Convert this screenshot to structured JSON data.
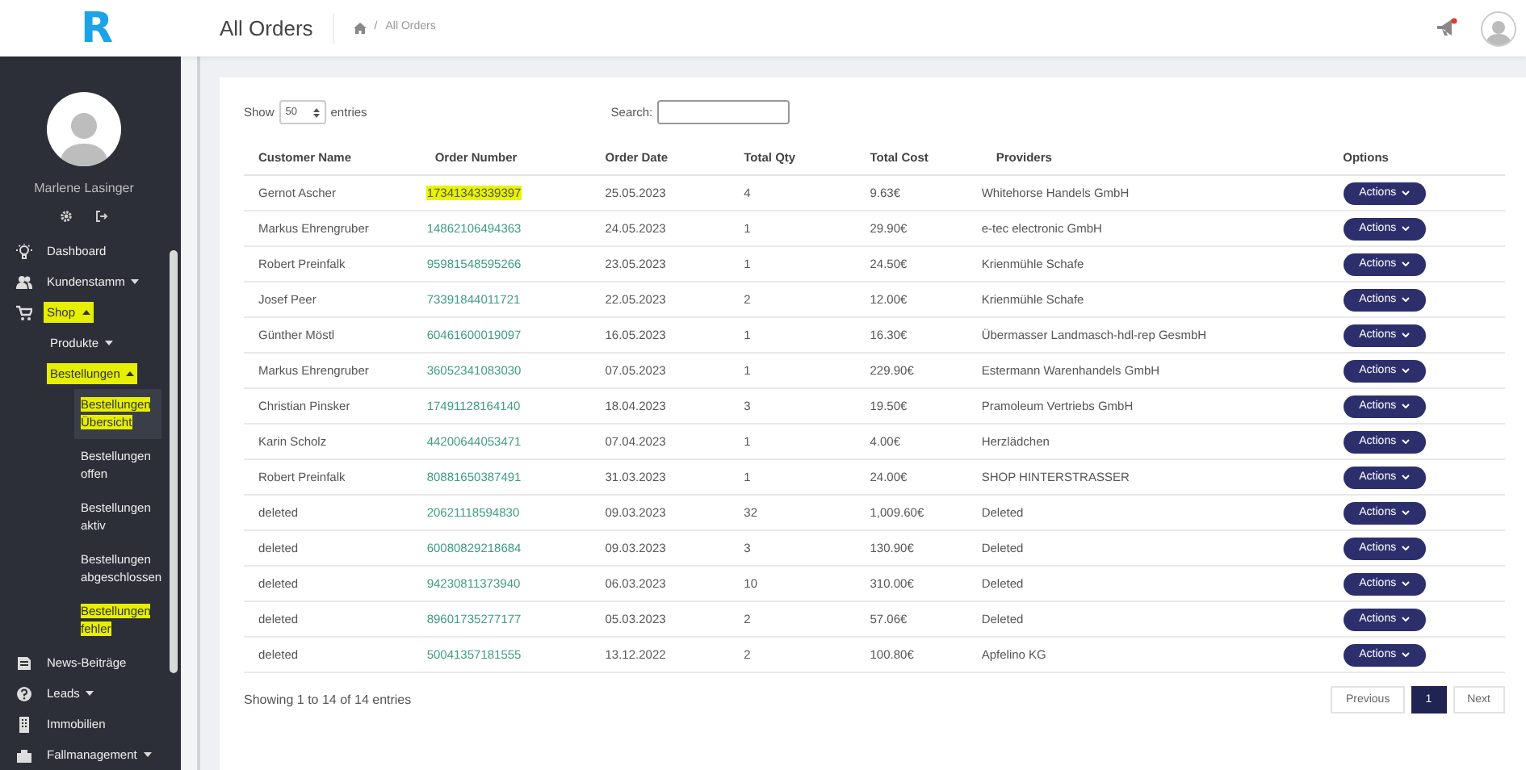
{
  "header": {
    "logo": "R",
    "title": "All Orders",
    "breadcrumb": {
      "separator": "/",
      "current": "All Orders"
    }
  },
  "profile": {
    "name": "Marlene Lasinger"
  },
  "sidebar": {
    "items": [
      {
        "label": "Dashboard",
        "highlighted": false
      },
      {
        "label": "Kundenstamm",
        "expanded": false,
        "highlighted": false
      },
      {
        "label": "Shop",
        "expanded": true,
        "highlighted": true,
        "children": [
          {
            "label": "Produkte",
            "expanded": false,
            "highlighted": false
          },
          {
            "label": "Bestellungen",
            "expanded": true,
            "highlighted": true,
            "children": [
              {
                "label": "Bestellungen Übersicht",
                "selected": true,
                "highlighted": true
              },
              {
                "label": "Bestellungen offen",
                "selected": false,
                "highlighted": false
              },
              {
                "label": "Bestellungen aktiv",
                "selected": false,
                "highlighted": false
              },
              {
                "label": "Bestellungen abgeschlossen",
                "selected": false,
                "highlighted": false
              },
              {
                "label": "Bestellungen fehler",
                "selected": false,
                "highlighted": true
              }
            ]
          }
        ]
      },
      {
        "label": "News-Beiträge",
        "highlighted": false
      },
      {
        "label": "Leads",
        "expanded": false,
        "highlighted": false
      },
      {
        "label": "Immobilien",
        "highlighted": false
      },
      {
        "label": "Fallmanagement",
        "expanded": false,
        "highlighted": false
      }
    ]
  },
  "table_controls": {
    "show_label": "Show",
    "page_size": "50",
    "entries_label": "entries",
    "search_label": "Search:"
  },
  "table": {
    "columns": [
      "Customer Name",
      "Order Number",
      "Order Date",
      "Total Qty",
      "Total Cost",
      "Providers",
      "Options"
    ],
    "rows": [
      {
        "customer": "Gernot Ascher",
        "order_number": "17341343339397",
        "highlighted": true,
        "date": "25.05.2023",
        "qty": "4",
        "cost": "9.63€",
        "provider": "Whitehorse Handels GmbH",
        "action": "Actions"
      },
      {
        "customer": "Markus Ehrengruber",
        "order_number": "14862106494363",
        "highlighted": false,
        "date": "24.05.2023",
        "qty": "1",
        "cost": "29.90€",
        "provider": "e-tec electronic GmbH",
        "action": "Actions"
      },
      {
        "customer": "Robert Preinfalk",
        "order_number": "95981548595266",
        "highlighted": false,
        "date": "23.05.2023",
        "qty": "1",
        "cost": "24.50€",
        "provider": "Krienmühle Schafe",
        "action": "Actions"
      },
      {
        "customer": "Josef Peer",
        "order_number": "73391844011721",
        "highlighted": false,
        "date": "22.05.2023",
        "qty": "2",
        "cost": "12.00€",
        "provider": "Krienmühle Schafe",
        "action": "Actions"
      },
      {
        "customer": "Günther Möstl",
        "order_number": "60461600019097",
        "highlighted": false,
        "date": "16.05.2023",
        "qty": "1",
        "cost": "16.30€",
        "provider": "Übermasser Landmasch-hdl-rep GesmbH",
        "action": "Actions"
      },
      {
        "customer": "Markus Ehrengruber",
        "order_number": "36052341083030",
        "highlighted": false,
        "date": "07.05.2023",
        "qty": "1",
        "cost": "229.90€",
        "provider": "Estermann Warenhandels GmbH",
        "action": "Actions"
      },
      {
        "customer": "Christian Pinsker",
        "order_number": "17491128164140",
        "highlighted": false,
        "date": "18.04.2023",
        "qty": "3",
        "cost": "19.50€",
        "provider": "Pramoleum Vertriebs GmbH",
        "action": "Actions"
      },
      {
        "customer": "Karin Scholz",
        "order_number": "44200644053471",
        "highlighted": false,
        "date": "07.04.2023",
        "qty": "1",
        "cost": "4.00€",
        "provider": "Herzlädchen",
        "action": "Actions"
      },
      {
        "customer": "Robert Preinfalk",
        "order_number": "80881650387491",
        "highlighted": false,
        "date": "31.03.2023",
        "qty": "1",
        "cost": "24.00€",
        "provider": "SHOP HINTERSTRASSER",
        "action": "Actions"
      },
      {
        "customer": "deleted",
        "order_number": "20621118594830",
        "highlighted": false,
        "date": "09.03.2023",
        "qty": "32",
        "cost": "1,009.60€",
        "provider": "Deleted",
        "action": "Actions"
      },
      {
        "customer": "deleted",
        "order_number": "60080829218684",
        "highlighted": false,
        "date": "09.03.2023",
        "qty": "3",
        "cost": "130.90€",
        "provider": "Deleted",
        "action": "Actions"
      },
      {
        "customer": "deleted",
        "order_number": "94230811373940",
        "highlighted": false,
        "date": "06.03.2023",
        "qty": "10",
        "cost": "310.00€",
        "provider": "Deleted",
        "action": "Actions"
      },
      {
        "customer": "deleted",
        "order_number": "89601735277177",
        "highlighted": false,
        "date": "05.03.2023",
        "qty": "2",
        "cost": "57.06€",
        "provider": "Deleted",
        "action": "Actions"
      },
      {
        "customer": "deleted",
        "order_number": "50041357181555",
        "highlighted": false,
        "date": "13.12.2022",
        "qty": "2",
        "cost": "100.80€",
        "provider": "Apfelino KG",
        "action": "Actions"
      }
    ]
  },
  "footer": {
    "info": "Showing 1 to 14 of 14 entries",
    "pagination": [
      {
        "label": "Previous",
        "selected": false
      },
      {
        "label": "1",
        "selected": true
      },
      {
        "label": "Next",
        "selected": false
      }
    ]
  }
}
